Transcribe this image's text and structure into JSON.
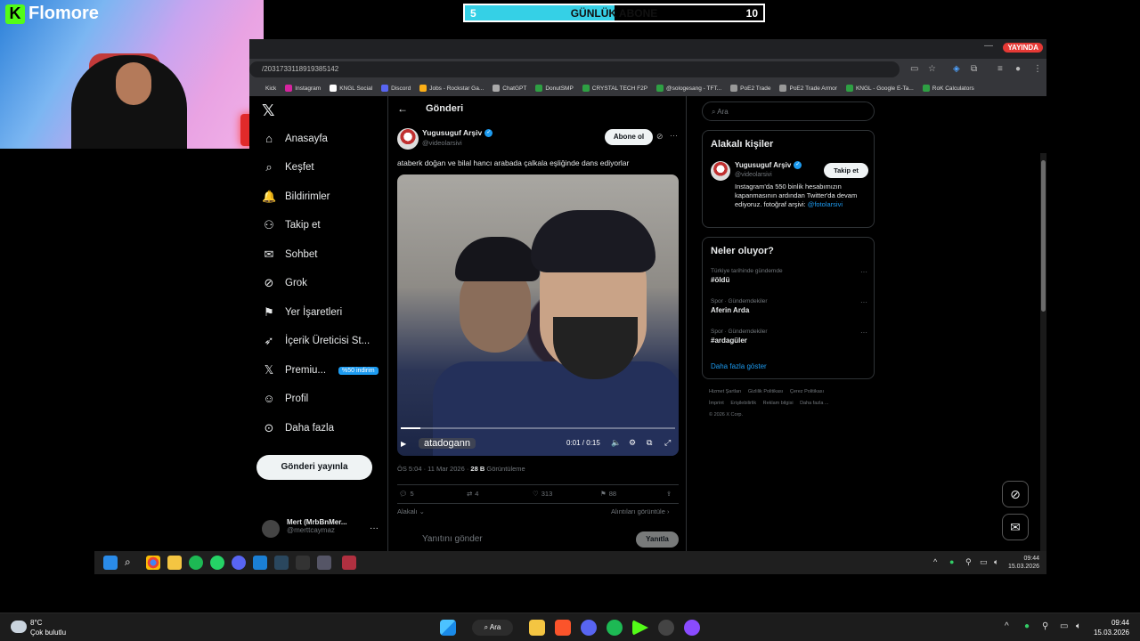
{
  "sub_counter": {
    "current": "5",
    "title": "GÜNLÜK ABONE",
    "goal": "10",
    "progress": 0.5
  },
  "cam": {
    "brand": "Flomore",
    "brand_icon": "K"
  },
  "browser": {
    "live_badge": "YAYINDA",
    "url": "/2031733118919385142",
    "bookmarks": [
      "Kick",
      "Instagram",
      "KNGL Social",
      "Discord",
      "Jobs - Rockstar Ga...",
      "ChatGPT",
      "DonutSMP",
      "CRYSTAL TECH F2P",
      "@sologesang - TFT...",
      "PoE2 Trade",
      "PoE2 Trade Armor",
      "KNGL - Google E-Ta...",
      "RoK Calculators"
    ]
  },
  "nav": {
    "items": [
      {
        "label": "Anasayfa",
        "icon": "home-icon",
        "glyph": "⌂"
      },
      {
        "label": "Keşfet",
        "icon": "search-icon",
        "glyph": "⌕"
      },
      {
        "label": "Bildirimler",
        "icon": "bell-icon",
        "glyph": "🔔"
      },
      {
        "label": "Takip et",
        "icon": "person-add-icon",
        "glyph": "⚇"
      },
      {
        "label": "Sohbet",
        "icon": "mail-icon",
        "glyph": "✉"
      },
      {
        "label": "Grok",
        "icon": "grok-icon",
        "glyph": "⊘"
      },
      {
        "label": "Yer İşaretleri",
        "icon": "bookmark-icon",
        "glyph": "⚑"
      },
      {
        "label": "İçerik Üreticisi St...",
        "icon": "rocket-icon",
        "glyph": "➶"
      },
      {
        "label": "Premiu...",
        "icon": "x-icon",
        "glyph": "𝕏"
      },
      {
        "label": "Profil",
        "icon": "profile-icon",
        "glyph": "☺"
      },
      {
        "label": "Daha fazla",
        "icon": "more-circle-icon",
        "glyph": "⊙"
      }
    ],
    "premium_badge": "%50 indirim",
    "post_button": "Gönderi yayınla",
    "account_name": "Mert (MrbBnMer...",
    "account_handle": "@merttcaymaz"
  },
  "post": {
    "header_title": "Gönderi",
    "author_name": "Yugusuguf Arşiv",
    "author_handle": "@videolarsivi",
    "follow_label": "Abone ol",
    "text": "ataberk doğan ve bilal hancı arabada çalkala eşliğinde dans ediyorlar",
    "video_watermark": "atadogann",
    "video_time": "0:01 / 0:15",
    "video_progress": 0.07,
    "time": "ÖS 5:04 · 11 Mar 2026 ·",
    "views_count": "28 B",
    "views_label": "Görüntüleme",
    "replies": "5",
    "reposts": "4",
    "likes": "313",
    "bookmarks": "88",
    "sort_label": "Alakalı",
    "quotes_label": "Alıntıları görüntüle",
    "reply_placeholder": "Yanıtını gönder",
    "reply_button": "Yanıtla"
  },
  "sidebar": {
    "search_placeholder": "Ara",
    "relevant_title": "Alakalı kişiler",
    "rp_name": "Yugusuguf Arşiv",
    "rp_handle": "@videolarsivi",
    "rp_follow": "Takip et",
    "rp_bio": "Instagram'da 550 binlik hesabımızın kapanmasının ardından Twitter'da devam ediyoruz. fotoğraf arşivi:",
    "rp_bio_link": "@fotolarsivi",
    "trends_title": "Neler oluyor?",
    "trends": [
      {
        "context": "Türkiye tarihinde gündemde",
        "name": "#öldü"
      },
      {
        "context": "Spor · Gündemdekiler",
        "name": "Aferin Arda"
      },
      {
        "context": "Spor · Gündemdekiler",
        "name": "#ardagüler"
      }
    ],
    "show_more": "Daha fazla göster",
    "footer": [
      "Hizmet Şartları",
      "Gizlilik Politikası",
      "Çerez Politikası",
      "İmprint",
      "Erişilebilirlik",
      "Reklam bilgisi",
      "Daha fazla ...",
      "© 2026 X Corp."
    ]
  },
  "inner_taskbar": {
    "time": "09:44",
    "date": "15.03.2026"
  },
  "taskbar": {
    "weather_temp": "8°C",
    "weather_desc": "Çok bulutlu",
    "search_label": "Ara",
    "time": "09:44",
    "date": "15.03.2026"
  }
}
